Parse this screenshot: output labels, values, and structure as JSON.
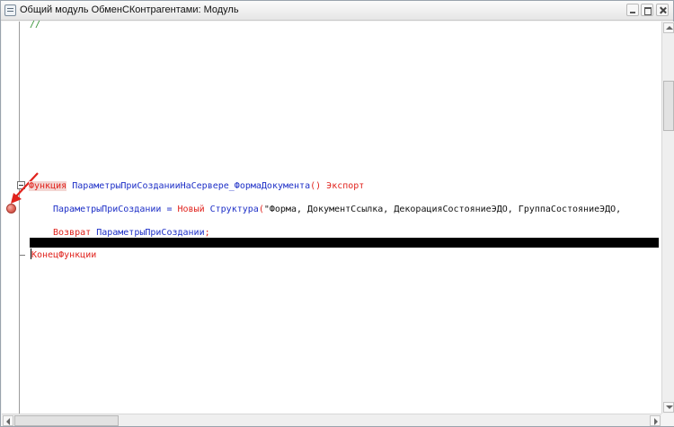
{
  "window": {
    "title": "Общий модуль ОбменСКонтрагентами: Модуль"
  },
  "icons": {
    "module": "module-icon",
    "minimize": "minimize-icon",
    "maximize": "maximize-icon",
    "close": "close-icon",
    "breakpoint": "breakpoint-icon",
    "arrow": "red-arrow-icon"
  },
  "colors": {
    "keyword": "#e0221c",
    "identifier": "#1d2fc7",
    "comment": "#2f8f2f",
    "current_line": "#000000",
    "breakpoint": "#e06a5e"
  },
  "code": {
    "comment": "//",
    "line1": {
      "keyword": "Функция",
      "name": "ПараметрыПриСозданииНаСервере_ФормаДокумента",
      "parens": "()",
      "export": "Экспорт"
    },
    "line2": {
      "var": "ПараметрыПриСоздании",
      "assign": " = ",
      "new": "Новый",
      "type": "Структура",
      "open": "(",
      "string": "\"Форма, ДокументСсылка, ДекорацияСостояниеЭДО, ГруппаСостояниеЭДО,"
    },
    "line3": {
      "keyword": "Возврат",
      "var": "ПараметрыПриСоздании",
      "semicolon": ";"
    },
    "line4": {
      "keyword": "КонецФункции"
    }
  }
}
